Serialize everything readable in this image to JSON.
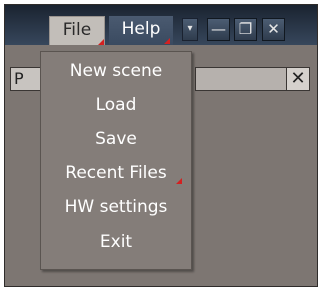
{
  "menubar": {
    "file_label": "File",
    "help_label": "Help"
  },
  "window_controls": {
    "dropdown_glyph": "▾",
    "minimize_glyph": "—",
    "maximize_glyph": "❐",
    "close_glyph": "✕"
  },
  "panel": {
    "tab_label": "P",
    "close_glyph": "✕"
  },
  "file_menu": {
    "items": [
      {
        "label": "New scene"
      },
      {
        "label": "Load"
      },
      {
        "label": "Save"
      },
      {
        "label": "Recent Files",
        "has_submenu": true
      },
      {
        "label": "HW settings"
      },
      {
        "label": "Exit"
      }
    ]
  },
  "colors": {
    "titlebar": "#37475c",
    "menu_bg": "#847d79",
    "submenu_marker": "#d42020"
  }
}
